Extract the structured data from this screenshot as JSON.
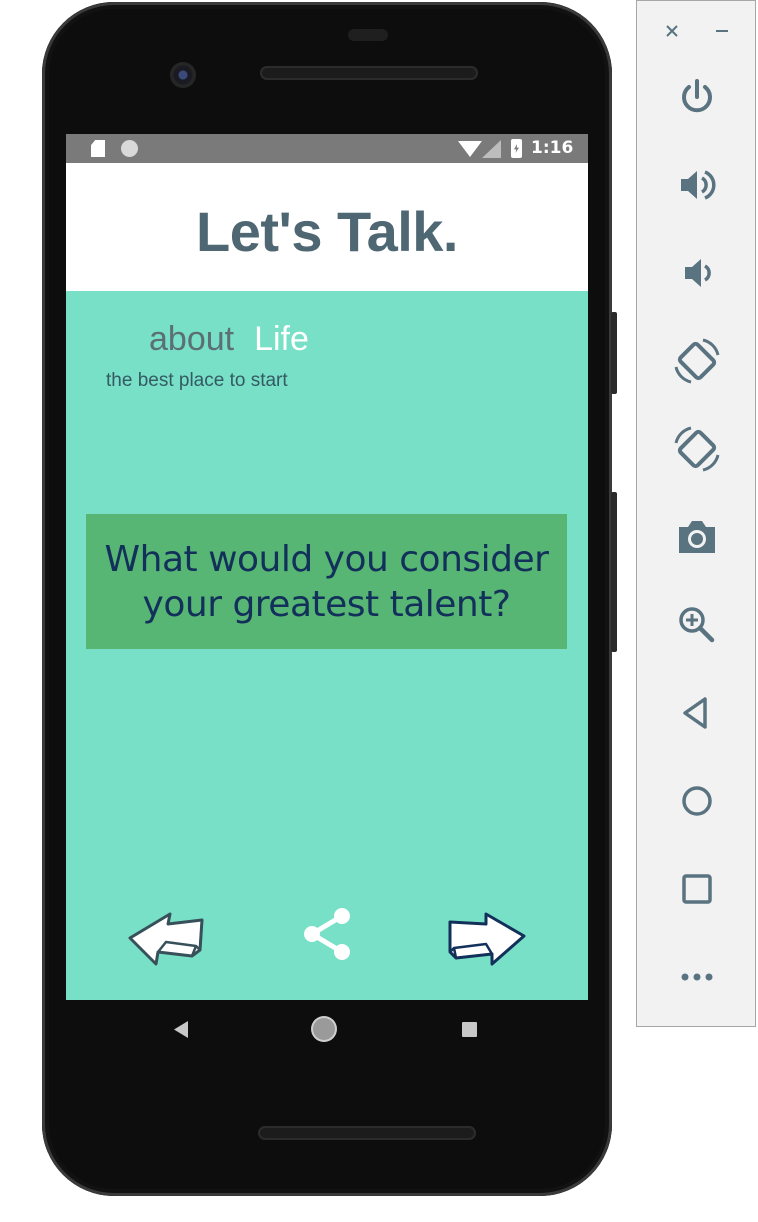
{
  "status_bar": {
    "time": "1:16"
  },
  "app": {
    "title": "Let's Talk.",
    "topic_prefix": "about",
    "topic_value": "Life",
    "subtitle": "the best place to start",
    "question": "What would you consider your greatest talent?"
  },
  "colors": {
    "screen_bg": "#77e0c7",
    "card_bg": "#57b674",
    "title": "#4e6773",
    "question_text": "#12305a"
  },
  "icons": {
    "back": "back-arrow-icon",
    "share": "share-icon",
    "next": "next-arrow-icon"
  },
  "emulator_panel": {
    "tools": [
      "close-icon",
      "minimize-icon",
      "power-icon",
      "volume-up-icon",
      "volume-down-icon",
      "rotate-left-icon",
      "rotate-right-icon",
      "camera-icon",
      "zoom-icon",
      "back-icon",
      "home-icon",
      "overview-icon",
      "more-icon"
    ]
  }
}
